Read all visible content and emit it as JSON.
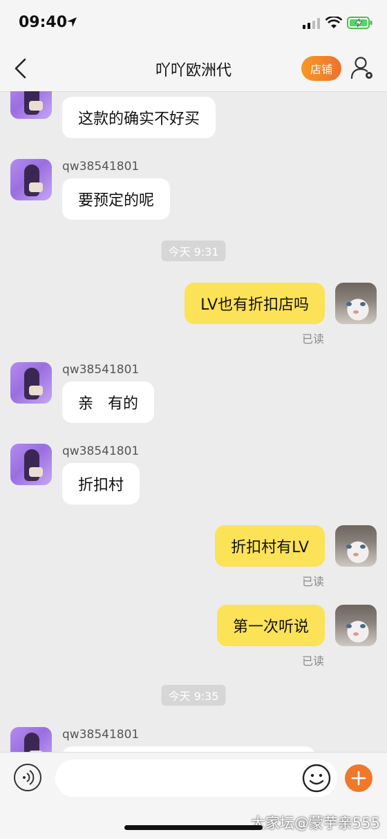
{
  "status_bar": {
    "time": "09:40"
  },
  "header": {
    "title": "吖吖欧洲代",
    "shop_button": "店铺"
  },
  "messages": {
    "m1": {
      "text": "这款的确实不好买"
    },
    "m2": {
      "sender": "qw38541801",
      "text": "要预定的呢"
    },
    "t1": {
      "text": "今天 9:31"
    },
    "m3": {
      "text": "LV也有折扣店吗",
      "status": "已读"
    },
    "m4": {
      "sender": "qw38541801",
      "text": "亲   有的"
    },
    "m5": {
      "sender": "qw38541801",
      "text": "折扣村"
    },
    "m6": {
      "text": "折扣村有LV",
      "status": "已读"
    },
    "m7": {
      "text": "第一次听说",
      "status": "已读"
    },
    "t2": {
      "text": "今天 9:35"
    },
    "m8": {
      "sender": "qw38541801"
    }
  },
  "input_bar": {
    "placeholder": ""
  },
  "watermark": "大家坛@蒙芋亲555",
  "colors": {
    "accent": "#f07030",
    "outgoing_bubble": "#fce256",
    "incoming_bubble": "#ffffff",
    "background": "#ececec"
  }
}
